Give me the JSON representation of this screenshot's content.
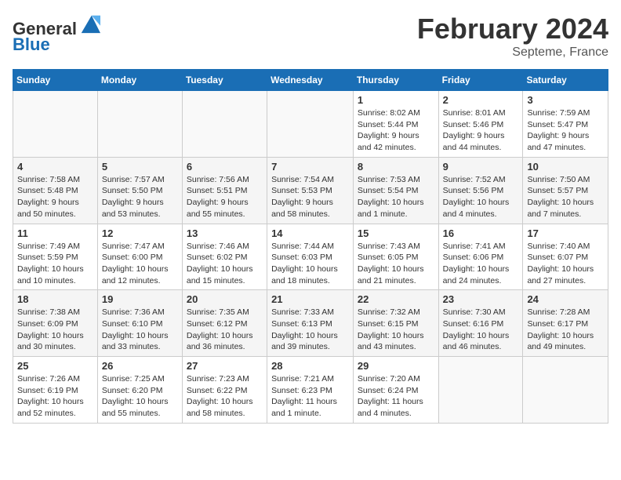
{
  "header": {
    "logo_line1": "General",
    "logo_line2": "Blue",
    "month": "February 2024",
    "location": "Septeme, France"
  },
  "weekdays": [
    "Sunday",
    "Monday",
    "Tuesday",
    "Wednesday",
    "Thursday",
    "Friday",
    "Saturday"
  ],
  "weeks": [
    [
      {
        "day": "",
        "info": ""
      },
      {
        "day": "",
        "info": ""
      },
      {
        "day": "",
        "info": ""
      },
      {
        "day": "",
        "info": ""
      },
      {
        "day": "1",
        "info": "Sunrise: 8:02 AM\nSunset: 5:44 PM\nDaylight: 9 hours\nand 42 minutes."
      },
      {
        "day": "2",
        "info": "Sunrise: 8:01 AM\nSunset: 5:46 PM\nDaylight: 9 hours\nand 44 minutes."
      },
      {
        "day": "3",
        "info": "Sunrise: 7:59 AM\nSunset: 5:47 PM\nDaylight: 9 hours\nand 47 minutes."
      }
    ],
    [
      {
        "day": "4",
        "info": "Sunrise: 7:58 AM\nSunset: 5:48 PM\nDaylight: 9 hours\nand 50 minutes."
      },
      {
        "day": "5",
        "info": "Sunrise: 7:57 AM\nSunset: 5:50 PM\nDaylight: 9 hours\nand 53 minutes."
      },
      {
        "day": "6",
        "info": "Sunrise: 7:56 AM\nSunset: 5:51 PM\nDaylight: 9 hours\nand 55 minutes."
      },
      {
        "day": "7",
        "info": "Sunrise: 7:54 AM\nSunset: 5:53 PM\nDaylight: 9 hours\nand 58 minutes."
      },
      {
        "day": "8",
        "info": "Sunrise: 7:53 AM\nSunset: 5:54 PM\nDaylight: 10 hours\nand 1 minute."
      },
      {
        "day": "9",
        "info": "Sunrise: 7:52 AM\nSunset: 5:56 PM\nDaylight: 10 hours\nand 4 minutes."
      },
      {
        "day": "10",
        "info": "Sunrise: 7:50 AM\nSunset: 5:57 PM\nDaylight: 10 hours\nand 7 minutes."
      }
    ],
    [
      {
        "day": "11",
        "info": "Sunrise: 7:49 AM\nSunset: 5:59 PM\nDaylight: 10 hours\nand 10 minutes."
      },
      {
        "day": "12",
        "info": "Sunrise: 7:47 AM\nSunset: 6:00 PM\nDaylight: 10 hours\nand 12 minutes."
      },
      {
        "day": "13",
        "info": "Sunrise: 7:46 AM\nSunset: 6:02 PM\nDaylight: 10 hours\nand 15 minutes."
      },
      {
        "day": "14",
        "info": "Sunrise: 7:44 AM\nSunset: 6:03 PM\nDaylight: 10 hours\nand 18 minutes."
      },
      {
        "day": "15",
        "info": "Sunrise: 7:43 AM\nSunset: 6:05 PM\nDaylight: 10 hours\nand 21 minutes."
      },
      {
        "day": "16",
        "info": "Sunrise: 7:41 AM\nSunset: 6:06 PM\nDaylight: 10 hours\nand 24 minutes."
      },
      {
        "day": "17",
        "info": "Sunrise: 7:40 AM\nSunset: 6:07 PM\nDaylight: 10 hours\nand 27 minutes."
      }
    ],
    [
      {
        "day": "18",
        "info": "Sunrise: 7:38 AM\nSunset: 6:09 PM\nDaylight: 10 hours\nand 30 minutes."
      },
      {
        "day": "19",
        "info": "Sunrise: 7:36 AM\nSunset: 6:10 PM\nDaylight: 10 hours\nand 33 minutes."
      },
      {
        "day": "20",
        "info": "Sunrise: 7:35 AM\nSunset: 6:12 PM\nDaylight: 10 hours\nand 36 minutes."
      },
      {
        "day": "21",
        "info": "Sunrise: 7:33 AM\nSunset: 6:13 PM\nDaylight: 10 hours\nand 39 minutes."
      },
      {
        "day": "22",
        "info": "Sunrise: 7:32 AM\nSunset: 6:15 PM\nDaylight: 10 hours\nand 43 minutes."
      },
      {
        "day": "23",
        "info": "Sunrise: 7:30 AM\nSunset: 6:16 PM\nDaylight: 10 hours\nand 46 minutes."
      },
      {
        "day": "24",
        "info": "Sunrise: 7:28 AM\nSunset: 6:17 PM\nDaylight: 10 hours\nand 49 minutes."
      }
    ],
    [
      {
        "day": "25",
        "info": "Sunrise: 7:26 AM\nSunset: 6:19 PM\nDaylight: 10 hours\nand 52 minutes."
      },
      {
        "day": "26",
        "info": "Sunrise: 7:25 AM\nSunset: 6:20 PM\nDaylight: 10 hours\nand 55 minutes."
      },
      {
        "day": "27",
        "info": "Sunrise: 7:23 AM\nSunset: 6:22 PM\nDaylight: 10 hours\nand 58 minutes."
      },
      {
        "day": "28",
        "info": "Sunrise: 7:21 AM\nSunset: 6:23 PM\nDaylight: 11 hours\nand 1 minute."
      },
      {
        "day": "29",
        "info": "Sunrise: 7:20 AM\nSunset: 6:24 PM\nDaylight: 11 hours\nand 4 minutes."
      },
      {
        "day": "",
        "info": ""
      },
      {
        "day": "",
        "info": ""
      }
    ]
  ]
}
